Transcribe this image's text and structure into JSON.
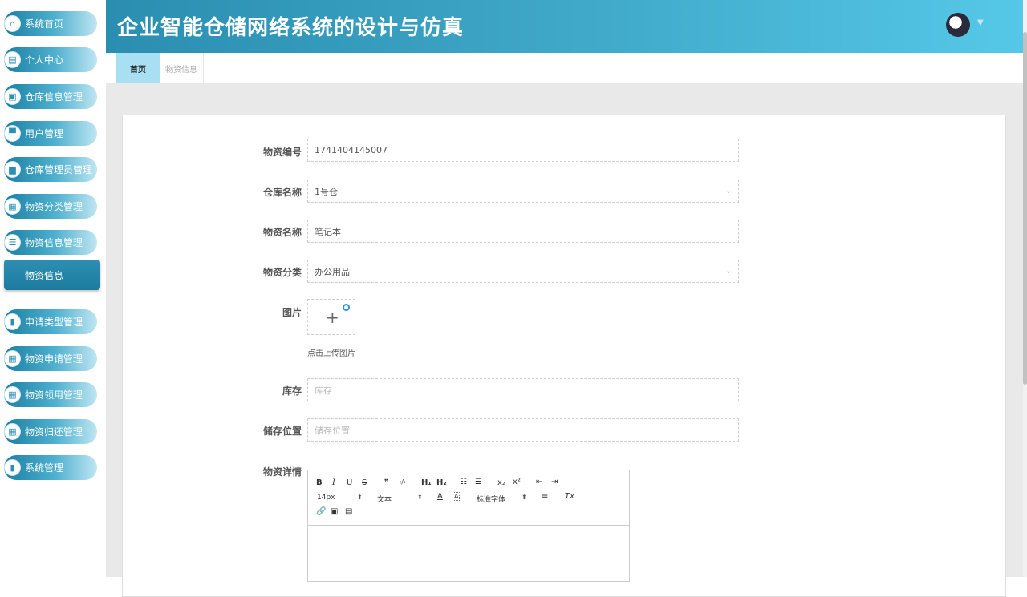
{
  "app": {
    "title": "企业智能仓储网络系统的设计与仿真"
  },
  "sidebar": {
    "items": [
      {
        "label": "系统首页",
        "icon": "⌂"
      },
      {
        "label": "个人中心",
        "icon": "▤"
      },
      {
        "label": "仓库信息管理",
        "icon": "▣"
      },
      {
        "label": "用户管理",
        "icon": "▀"
      },
      {
        "label": "仓库管理员管理",
        "icon": "▆"
      },
      {
        "label": "物资分类管理",
        "icon": "▦"
      },
      {
        "label": "物资信息管理",
        "icon": "☰"
      },
      {
        "label": "申请类型管理",
        "icon": "▮"
      },
      {
        "label": "物资申请管理",
        "icon": "▦"
      },
      {
        "label": "物资领用管理",
        "icon": "▦"
      },
      {
        "label": "物资归还管理",
        "icon": "▦"
      },
      {
        "label": "系统管理",
        "icon": "▮"
      }
    ],
    "sub_item": "物资信息"
  },
  "tabs": [
    {
      "label": "首页",
      "active": true
    },
    {
      "label": "物资信息",
      "active": false
    }
  ],
  "form": {
    "code_label": "物资编号",
    "code_value": "1741404145007",
    "warehouse_label": "仓库名称",
    "warehouse_value": "1号仓",
    "name_label": "物资名称",
    "name_value": "笔记本",
    "category_label": "物资分类",
    "category_value": "办公用品",
    "image_label": "图片",
    "upload_hint": "点击上传图片",
    "stock_label": "库存",
    "stock_placeholder": "库存",
    "location_label": "储存位置",
    "location_placeholder": "储存位置",
    "detail_label": "物资详情"
  },
  "editor": {
    "toolbar_row1": [
      "B",
      "I",
      "U",
      "S",
      "❞",
      "‹/›",
      "H₁",
      "H₂",
      "☷",
      "☰",
      "x₂",
      "x²",
      "⇤",
      "⇥"
    ],
    "font_size": "14px",
    "text_style": "文本",
    "font_family": "标准字体",
    "color_a": "A",
    "bg_a": "A",
    "align": "≡",
    "clear": "Tx"
  },
  "colors": {
    "accent": "#3fa7c8",
    "active_tab": "#a9dff2"
  }
}
